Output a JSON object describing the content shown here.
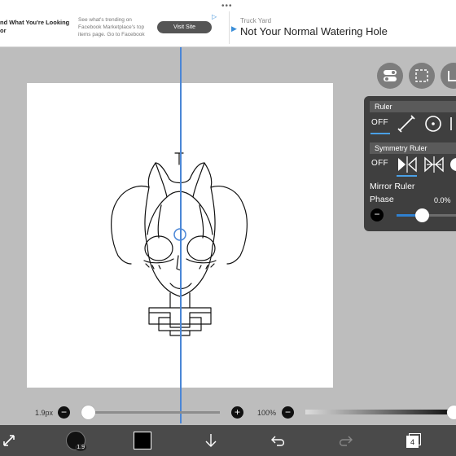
{
  "ad": {
    "dots": "•••",
    "left_title": "nd What You're Looking\nor",
    "left_desc": "See what's trending on Facebook Marketplace's top items page. Go to Facebook",
    "visit_label": "Visit Site",
    "info_icon": "ad-choices-icon",
    "right_small": "Truck Yard",
    "right_title": "Not Your Normal Watering Hole"
  },
  "panel": {
    "ruler_title": "Ruler",
    "ruler_off": "OFF",
    "symmetry_title": "Symmetry Ruler",
    "symmetry_off": "OFF",
    "mirror_label": "Mirror Ruler",
    "phase_label": "Phase",
    "phase_value": "0.0%",
    "phase_minus": "−",
    "phase_fraction": 0.0
  },
  "bottom": {
    "brush_size": "1.9px",
    "brush_minus": "−",
    "brush_plus": "+",
    "brush_size_fraction": 0.0,
    "zoom": "100%",
    "layer_count": "4",
    "brush_badge": "1.9"
  },
  "colors": {
    "accent": "#4aa0e6",
    "panel_bg": "#3f3f3f",
    "toolbar_bg": "#4a4a4a",
    "guide": "#4a86d6"
  }
}
